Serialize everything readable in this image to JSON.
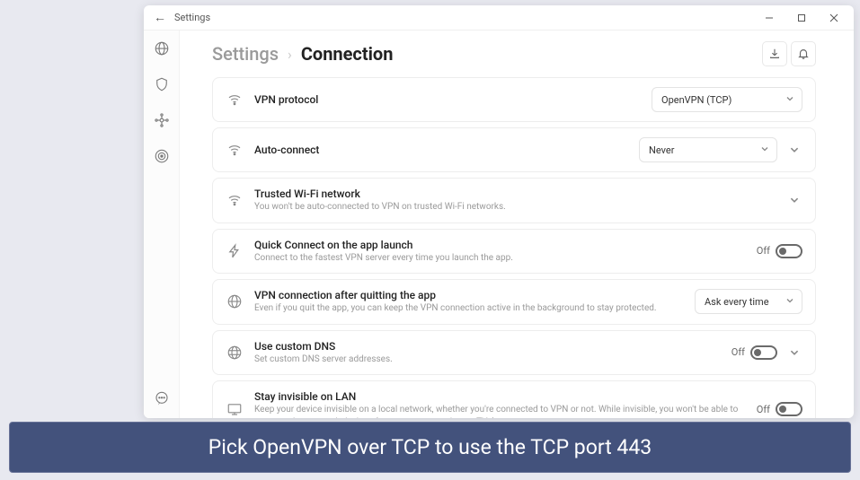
{
  "titlebar": {
    "label": "Settings"
  },
  "breadcrumb": {
    "parent": "Settings",
    "separator": "›",
    "current": "Connection"
  },
  "sidebar": {
    "items": [
      "globe",
      "shield",
      "node",
      "target"
    ],
    "bottom": "chat"
  },
  "cards": {
    "vpn_protocol": {
      "title": "VPN protocol",
      "value": "OpenVPN (TCP)"
    },
    "auto_connect": {
      "title": "Auto-connect",
      "value": "Never"
    },
    "trusted_wifi": {
      "title": "Trusted Wi-Fi network",
      "desc": "You won't be auto-connected to VPN on trusted Wi-Fi networks."
    },
    "quick_connect": {
      "title": "Quick Connect on the app launch",
      "desc": "Connect to the fastest VPN server every time you launch the app.",
      "toggle_label": "Off"
    },
    "after_quit": {
      "title": "VPN connection after quitting the app",
      "desc": "Even if you quit the app, you can keep the VPN connection active in the background to stay protected.",
      "value": "Ask every time"
    },
    "custom_dns": {
      "title": "Use custom DNS",
      "desc": "Set custom DNS server addresses.",
      "toggle_label": "Off"
    },
    "stay_invisible": {
      "title": "Stay invisible on LAN",
      "desc": "Keep your device invisible on a local network, whether you're connected to VPN or not. While invisible, you won't be able to access other network devices (e.g. computers, printers, TVs).",
      "toggle_label": "Off"
    }
  },
  "caption": "Pick OpenVPN over TCP to use the TCP port 443"
}
